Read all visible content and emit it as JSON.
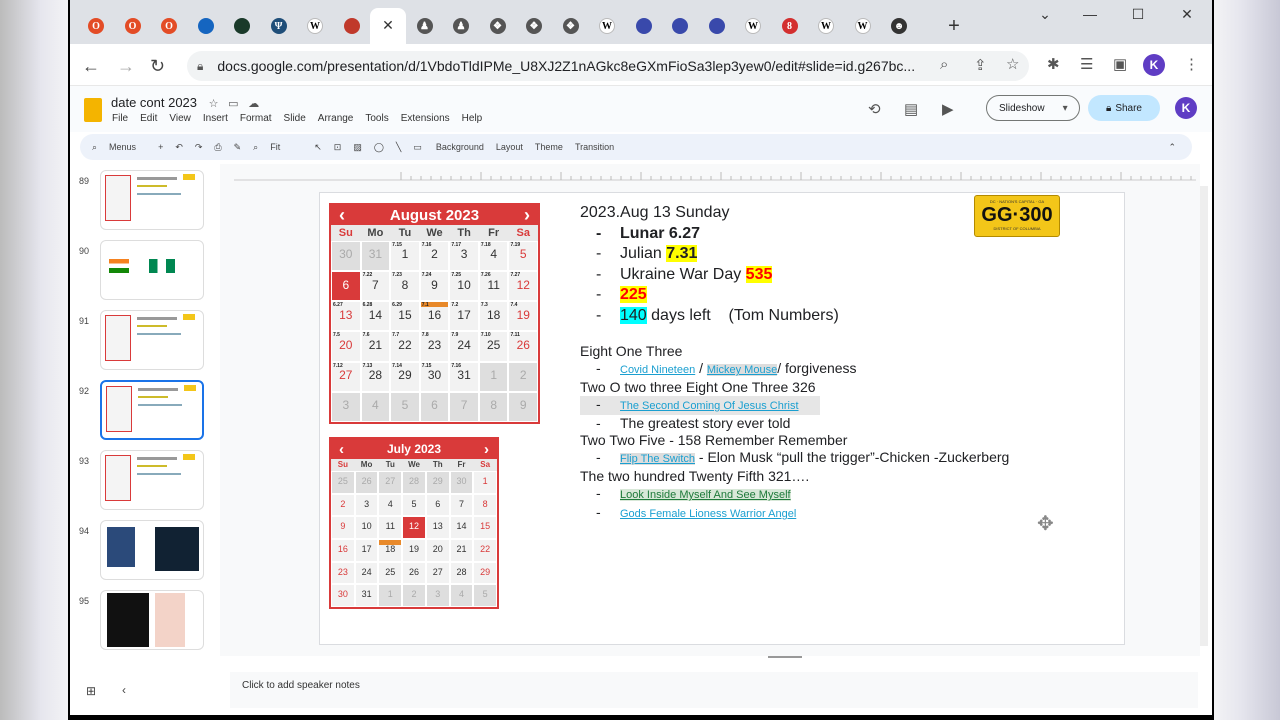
{
  "browser": {
    "tabs": [
      {
        "icon": "opera-icon",
        "color": "#e34c26",
        "glyph": "O"
      },
      {
        "icon": "opera-icon",
        "color": "#e34c26",
        "glyph": "O"
      },
      {
        "icon": "opera-icon",
        "color": "#e34c26",
        "glyph": "O"
      },
      {
        "icon": "globe-icon",
        "color": "#1565c0",
        "glyph": ""
      },
      {
        "icon": "square-logo-icon",
        "color": "#1a3a2a",
        "glyph": ""
      },
      {
        "icon": "trident-icon",
        "color": "#1f4e79",
        "glyph": "Ψ"
      },
      {
        "icon": "wikipedia-icon",
        "color": "#ffffff",
        "glyph": "W"
      },
      {
        "icon": "circle-logo-icon",
        "color": "#c0392b",
        "glyph": ""
      },
      {
        "icon": "close-icon",
        "color": "#ffffff",
        "glyph": "✕"
      },
      {
        "icon": "figure-icon",
        "color": "#555",
        "glyph": "♟"
      },
      {
        "icon": "figure-icon",
        "color": "#555",
        "glyph": "♟"
      },
      {
        "icon": "bird-icon",
        "color": "#555",
        "glyph": "❖"
      },
      {
        "icon": "bird-icon",
        "color": "#555",
        "glyph": "❖"
      },
      {
        "icon": "bird-icon",
        "color": "#555",
        "glyph": "❖"
      },
      {
        "icon": "wikipedia-icon",
        "color": "#ffffff",
        "glyph": "W"
      },
      {
        "icon": "planet-icon",
        "color": "#3949ab",
        "glyph": ""
      },
      {
        "icon": "planet-icon",
        "color": "#3949ab",
        "glyph": ""
      },
      {
        "icon": "planet-icon",
        "color": "#3949ab",
        "glyph": ""
      },
      {
        "icon": "wikipedia-icon",
        "color": "#ffffff",
        "glyph": "W"
      },
      {
        "icon": "red-logo-icon",
        "color": "#d32f2f",
        "glyph": "8"
      },
      {
        "icon": "wikipedia-icon",
        "color": "#ffffff",
        "glyph": "W"
      },
      {
        "icon": "wikipedia-icon",
        "color": "#ffffff",
        "glyph": "W"
      },
      {
        "icon": "smiley-icon",
        "color": "#333",
        "glyph": "☻"
      }
    ],
    "new_tab_glyph": "+",
    "url": "docs.google.com/presentation/d/1VbdoTldIPMe_U8XJ2Z1nAGkc8eGXmFioSa3lep3yew0/edit#slide=id.g267bc...",
    "avatar_letter": "K"
  },
  "app": {
    "title": "date cont 2023",
    "menus": [
      "File",
      "Edit",
      "View",
      "Insert",
      "Format",
      "Slide",
      "Arrange",
      "Tools",
      "Extensions",
      "Help"
    ],
    "slideshow_label": "Slideshow",
    "share_label": "Share",
    "avatar_letter": "K",
    "toolbar": {
      "search": "Menus",
      "zoom": "Fit",
      "background": "Background",
      "layout": "Layout",
      "theme": "Theme",
      "transition": "Transition"
    }
  },
  "filmstrip": [
    {
      "num": "89"
    },
    {
      "num": "90"
    },
    {
      "num": "91"
    },
    {
      "num": "92",
      "selected": true
    },
    {
      "num": "93"
    },
    {
      "num": "94"
    },
    {
      "num": "95"
    }
  ],
  "slide": {
    "plate": {
      "top": "DC · NATION'S CAPITAL · GA",
      "main": "GG·300",
      "bottom": "DISTRICT OF COLUMBIA"
    },
    "aug": {
      "title": "August 2023",
      "dows": [
        "Su",
        "Mo",
        "Tu",
        "We",
        "Th",
        "Fr",
        "Sa"
      ],
      "weeks": [
        [
          {
            "n": "30",
            "o": true
          },
          {
            "n": "31",
            "o": true
          },
          {
            "n": "1",
            "t": "7.15"
          },
          {
            "n": "2",
            "t": "7.16"
          },
          {
            "n": "3",
            "t": "7.17"
          },
          {
            "n": "4",
            "t": "7.18"
          },
          {
            "n": "5",
            "t": "7.19",
            "r": true
          }
        ],
        [
          {
            "n": "6",
            "today": true
          },
          {
            "n": "7",
            "t": "7.22"
          },
          {
            "n": "8",
            "t": "7.23"
          },
          {
            "n": "9",
            "t": "7.24"
          },
          {
            "n": "10",
            "t": "7.25"
          },
          {
            "n": "11",
            "t": "7.26"
          },
          {
            "n": "12",
            "t": "7.27",
            "r": true
          }
        ],
        [
          {
            "n": "13",
            "t": "6.27",
            "r": true
          },
          {
            "n": "14",
            "t": "6.28"
          },
          {
            "n": "15",
            "t": "6.29"
          },
          {
            "n": "16",
            "t": "7.1",
            "mark": true
          },
          {
            "n": "17",
            "t": "7.2"
          },
          {
            "n": "18",
            "t": "7.3"
          },
          {
            "n": "19",
            "t": "7.4",
            "r": true
          }
        ],
        [
          {
            "n": "20",
            "t": "7.5",
            "r": true
          },
          {
            "n": "21",
            "t": "7.6"
          },
          {
            "n": "22",
            "t": "7.7"
          },
          {
            "n": "23",
            "t": "7.8"
          },
          {
            "n": "24",
            "t": "7.9"
          },
          {
            "n": "25",
            "t": "7.10"
          },
          {
            "n": "26",
            "t": "7.11",
            "r": true
          }
        ],
        [
          {
            "n": "27",
            "t": "7.12",
            "r": true
          },
          {
            "n": "28",
            "t": "7.13"
          },
          {
            "n": "29",
            "t": "7.14"
          },
          {
            "n": "30",
            "t": "7.15"
          },
          {
            "n": "31",
            "t": "7.16"
          },
          {
            "n": "1",
            "o": true
          },
          {
            "n": "2",
            "o": true
          }
        ],
        [
          {
            "n": "3",
            "o": true
          },
          {
            "n": "4",
            "o": true
          },
          {
            "n": "5",
            "o": true
          },
          {
            "n": "6",
            "o": true
          },
          {
            "n": "7",
            "o": true
          },
          {
            "n": "8",
            "o": true
          },
          {
            "n": "9",
            "o": true
          }
        ]
      ]
    },
    "jul": {
      "title": "July 2023",
      "dows": [
        "Su",
        "Mo",
        "Tu",
        "We",
        "Th",
        "Fr",
        "Sa"
      ],
      "weeks": [
        [
          {
            "n": "25",
            "o": true
          },
          {
            "n": "26",
            "o": true
          },
          {
            "n": "27",
            "o": true
          },
          {
            "n": "28",
            "o": true
          },
          {
            "n": "29",
            "o": true
          },
          {
            "n": "30",
            "o": true
          },
          {
            "n": "1",
            "r": true
          }
        ],
        [
          {
            "n": "2",
            "r": true
          },
          {
            "n": "3"
          },
          {
            "n": "4"
          },
          {
            "n": "5"
          },
          {
            "n": "6"
          },
          {
            "n": "7"
          },
          {
            "n": "8",
            "r": true
          }
        ],
        [
          {
            "n": "9",
            "r": true
          },
          {
            "n": "10"
          },
          {
            "n": "11"
          },
          {
            "n": "12",
            "today": true
          },
          {
            "n": "13"
          },
          {
            "n": "14"
          },
          {
            "n": "15",
            "r": true
          }
        ],
        [
          {
            "n": "16",
            "r": true
          },
          {
            "n": "17"
          },
          {
            "n": "18",
            "mark": true
          },
          {
            "n": "19"
          },
          {
            "n": "20"
          },
          {
            "n": "21"
          },
          {
            "n": "22",
            "r": true
          }
        ],
        [
          {
            "n": "23",
            "r": true
          },
          {
            "n": "24"
          },
          {
            "n": "25"
          },
          {
            "n": "26"
          },
          {
            "n": "27"
          },
          {
            "n": "28"
          },
          {
            "n": "29",
            "r": true
          }
        ],
        [
          {
            "n": "30",
            "r": true
          },
          {
            "n": "31"
          },
          {
            "n": "1",
            "o": true
          },
          {
            "n": "2",
            "o": true
          },
          {
            "n": "3",
            "o": true
          },
          {
            "n": "4",
            "o": true
          },
          {
            "n": "5",
            "o": true
          }
        ]
      ]
    },
    "text": {
      "date_line": "2023.Aug 13 Sunday",
      "lunar": "Lunar 6.27",
      "julian_label": "Julian",
      "julian_val": "7.31",
      "war_label": "Ukraine War Day",
      "war_val": "535",
      "n225": "225",
      "days_val": "140",
      "days_label": "days left",
      "tom": "(Tom Numbers)",
      "eight_one_three": "Eight One Three",
      "covid": "Covid Nineteen",
      "slash": "/",
      "mickey": "Mickey Mouse",
      "forgiveness": "/ forgiveness",
      "two_o": "Two O two three Eight One Three 326",
      "second_coming": "The Second Coming Of Jesus Christ",
      "greatest": "The greatest story ever told",
      "two_two_five": "Two Two Five - 158 Remember Remember",
      "flip": "Flip The Switch",
      "elon": "- Elon Musk “pull the trigger”-Chicken -Zuckerberg",
      "two_hundred": "The two hundred Twenty Fifth 321….",
      "look_inside": "Look Inside Myself And See Myself",
      "gods": "Gods Female Lioness Warrior Angel"
    }
  },
  "notes_placeholder": "Click to add speaker notes"
}
